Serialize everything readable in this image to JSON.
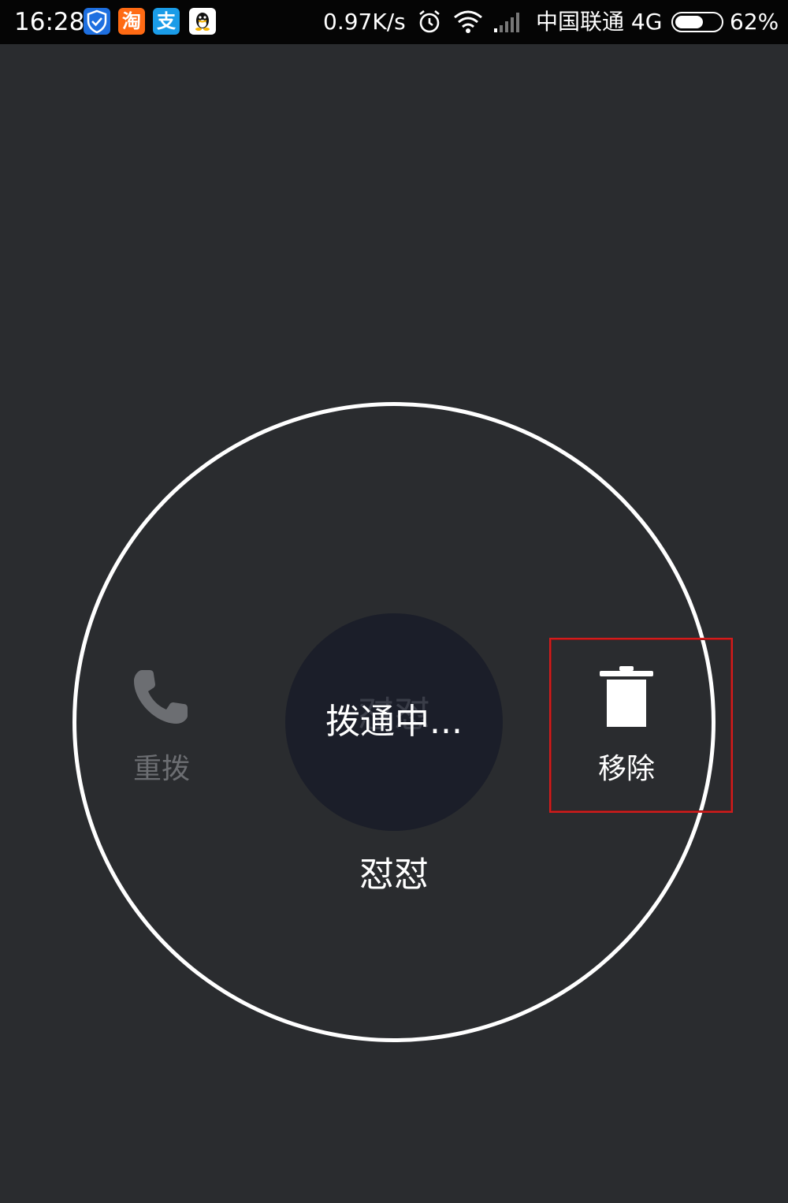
{
  "status_bar": {
    "time": "16:28",
    "app_icons": [
      {
        "name": "shield-app-icon",
        "glyph": "✓"
      },
      {
        "name": "taobao-app-icon",
        "glyph": "淘"
      },
      {
        "name": "alipay-app-icon",
        "glyph": "支"
      },
      {
        "name": "qq-app-icon",
        "glyph": "🐧"
      }
    ],
    "net_speed": "0.97K/s",
    "carrier": "中国联通 4G",
    "battery_percent": "62%",
    "battery_level": 0.62
  },
  "call": {
    "status_text": "拨通中...",
    "contact_name": "怼怼",
    "redial_label": "重拨",
    "remove_label": "移除"
  },
  "colors": {
    "background": "#2a2c2f",
    "ring": "#ffffff",
    "avatar": "#1b1e29",
    "redial_disabled": "#6c6e72",
    "highlight": "#d21c1c"
  }
}
